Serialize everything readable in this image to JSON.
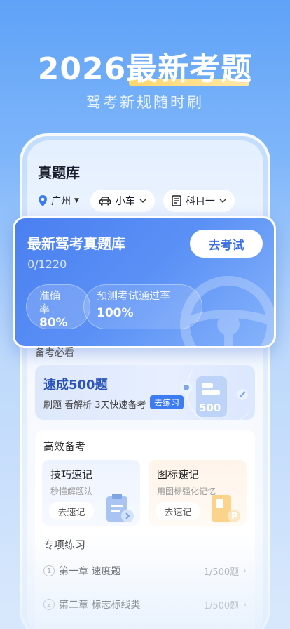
{
  "hero": {
    "year": "2026",
    "highlight": "最新考题",
    "subtitle": "驾考新规随时刷"
  },
  "page": {
    "title": "真题库"
  },
  "filters": {
    "city": "广州",
    "vehicle": "小车",
    "subject": "科目一"
  },
  "feature": {
    "title": "最新驾考真题库",
    "progress": "0/1220",
    "button": "去考试",
    "stats": [
      {
        "label": "准确率",
        "value": "80%"
      },
      {
        "label": "预测考试通过率",
        "value": "100%"
      }
    ]
  },
  "prep": {
    "section_label": "备考必看",
    "speed_title": "速成500题",
    "speed_desc": "刷题 看解析 3天快速备考",
    "speed_button": "去练习",
    "speed_art_text": "500"
  },
  "efficient": {
    "title": "高效备考",
    "tiles": [
      {
        "title": "技巧速记",
        "subtitle": "秒懂解题法",
        "button": "去速记"
      },
      {
        "title": "图标速记",
        "subtitle": "用图标强化记忆",
        "button": "去速记"
      }
    ],
    "special_title": "专项练习",
    "chapters": [
      {
        "num": "1",
        "name": "第一章  速度题",
        "count": "1/500题"
      },
      {
        "num": "2",
        "name": "第二章  标志标线类",
        "count": "1/500题"
      }
    ]
  },
  "colors": {
    "accent": "#3d7bf2",
    "brand_blue": "#4a7ff0",
    "highlight_yellow": "#ffd66b"
  }
}
